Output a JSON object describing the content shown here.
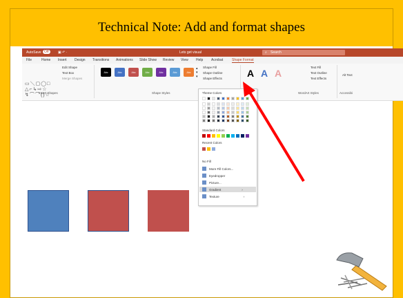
{
  "slide": {
    "title": "Technical Note: Add and format shapes"
  },
  "titlebar": {
    "autosave": "AutoSave",
    "toggle": "Off",
    "doc_title": "Lets get visual",
    "search_placeholder": "Search"
  },
  "tabs": [
    "File",
    "Home",
    "Insert",
    "Design",
    "Transitions",
    "Animations",
    "Slide Show",
    "Review",
    "View",
    "Help",
    "Acrobat",
    "Shape Format"
  ],
  "ribbon": {
    "edit_shape": "Edit Shape",
    "text_box": "Text Box",
    "merge_shapes": "Merge Shapes",
    "insert_shapes": "Insert Shapes",
    "shape_styles": "Shape Styles",
    "style_swatch": "Abc",
    "shape_fill": "Shape Fill",
    "shape_outline": "Shape Outline",
    "shape_effects": "Shape Effects",
    "wordart_styles": "WordArt Styles",
    "text_fill": "Text Fill",
    "text_outline": "Text Outline",
    "text_effects": "Text Effects",
    "alt_text": "Alt Text",
    "accessibility": "Accessibi"
  },
  "style_colors": [
    "#000000",
    "#4472c4",
    "#c0504d",
    "#70ad47",
    "#7030a0",
    "#5b9bd5",
    "#ed7d31"
  ],
  "dropdown": {
    "theme_colors": "Theme Colors",
    "standard_colors": "Standard Colors",
    "recent_colors": "Recent Colors",
    "no_fill": "No Fill",
    "more_fill_colors": "More Fill Colors...",
    "eyedropper": "Eyedropper",
    "picture": "Picture...",
    "gradient": "Gradient",
    "texture": "Texture"
  },
  "theme_row": [
    "#ffffff",
    "#000000",
    "#e7e6e6",
    "#44546a",
    "#4472c4",
    "#ed7d31",
    "#a5a5a5",
    "#ffc000",
    "#5b9bd5",
    "#70ad47"
  ],
  "standard_row": [
    "#c00000",
    "#ff0000",
    "#ffc000",
    "#ffff00",
    "#92d050",
    "#00b050",
    "#00b0f0",
    "#0070c0",
    "#002060",
    "#7030a0"
  ],
  "recent_row": [
    "#c0504d",
    "#ffc000",
    "#8faadc"
  ],
  "shapes": [
    {
      "name": "blue-square",
      "fill": "#4f81bd"
    },
    {
      "name": "red-square-outlined",
      "fill": "#c0504d"
    },
    {
      "name": "red-square",
      "fill": "#c0504d"
    }
  ],
  "colors": {
    "accent": "#ffc000",
    "arrow": "#ff0000",
    "office": "#b7472a"
  }
}
